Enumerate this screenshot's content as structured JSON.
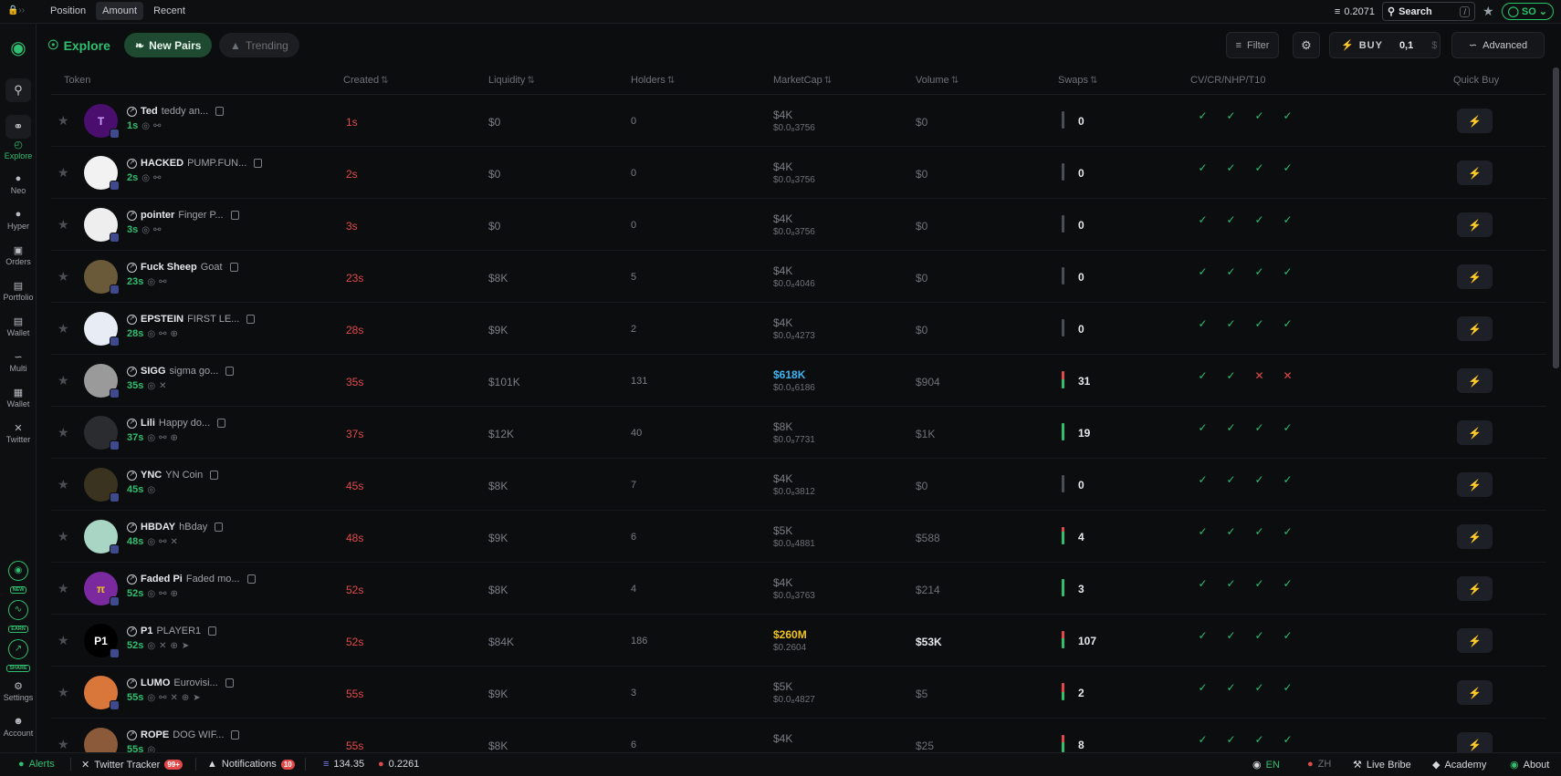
{
  "topbar": {
    "tabs": [
      {
        "label": "Position",
        "active": false
      },
      {
        "label": "Amount",
        "active": true
      },
      {
        "label": "Recent",
        "active": false
      }
    ],
    "balance": "0.2071",
    "search_label": "Search",
    "search_shortcut": "/",
    "user_initials": "SO"
  },
  "sidebar": {
    "items": [
      {
        "label": "Explore",
        "icon": "explore-icon",
        "active": true
      },
      {
        "label": "Neo",
        "icon": "neo-icon",
        "active": false
      },
      {
        "label": "Hyper",
        "icon": "hyper-icon",
        "active": false
      },
      {
        "label": "Orders",
        "icon": "orders-icon",
        "active": false
      },
      {
        "label": "Portfolio",
        "icon": "portfolio-icon",
        "active": false
      },
      {
        "label": "Wallet",
        "icon": "wallet-icon",
        "active": false
      },
      {
        "label": "Multi",
        "icon": "multi-chart-icon",
        "active": false
      },
      {
        "label": "Wallet",
        "icon": "wallet-doc-icon",
        "active": false
      },
      {
        "label": "Twitter",
        "icon": "x-icon",
        "active": false
      }
    ],
    "promos": [
      "NEW",
      "EARN",
      "SHARE"
    ],
    "bottom": [
      {
        "label": "Settings",
        "icon": "gear-icon"
      },
      {
        "label": "Account",
        "icon": "account-icon"
      }
    ]
  },
  "header": {
    "title": "Explore",
    "new_pairs": "New Pairs",
    "trending": "Trending",
    "filter": "Filter",
    "buy_label": "BUY",
    "buy_amount": "0,1",
    "buy_currency": "$",
    "advanced": "Advanced"
  },
  "table": {
    "columns": [
      "Token",
      "Created",
      "Liquidity",
      "Holders",
      "MarketCap",
      "Volume",
      "Swaps",
      "CV/CR/NHP/T10",
      "Quick Buy"
    ],
    "rows": [
      {
        "symbol": "Ted",
        "name": "teddy an...",
        "age": "1s",
        "created": "1s",
        "liquidity": "$0",
        "holders": "0",
        "mcap": "$4K",
        "price": "$0.0₈3756",
        "mcap_style": "normal",
        "volume": "$0",
        "volume_strong": false,
        "swaps": "0",
        "buy_frac": 0,
        "sell_frac": 0,
        "checks": [
          "ok",
          "ok",
          "ok",
          "ok"
        ],
        "avatar_text": "T",
        "avatar_bg": "#4a0f6e",
        "avatar_fg": "#c8a0ff",
        "socials": [
          "stat",
          "link"
        ]
      },
      {
        "symbol": "HACKED",
        "name": "PUMP.FUN...",
        "age": "2s",
        "created": "2s",
        "liquidity": "$0",
        "holders": "0",
        "mcap": "$4K",
        "price": "$0.0₈3756",
        "mcap_style": "normal",
        "volume": "$0",
        "volume_strong": false,
        "swaps": "0",
        "buy_frac": 0,
        "sell_frac": 0,
        "checks": [
          "ok",
          "ok",
          "ok",
          "ok"
        ],
        "avatar_text": "",
        "avatar_bg": "#f2f2f2",
        "avatar_fg": "#222",
        "socials": [
          "stat",
          "link"
        ]
      },
      {
        "symbol": "pointer",
        "name": "Finger P...",
        "age": "3s",
        "created": "3s",
        "liquidity": "$0",
        "holders": "0",
        "mcap": "$4K",
        "price": "$0.0₈3756",
        "mcap_style": "normal",
        "volume": "$0",
        "volume_strong": false,
        "swaps": "0",
        "buy_frac": 0,
        "sell_frac": 0,
        "checks": [
          "ok",
          "ok",
          "ok",
          "ok"
        ],
        "avatar_text": "",
        "avatar_bg": "#eeeeee",
        "avatar_fg": "#222",
        "socials": [
          "stat",
          "link"
        ]
      },
      {
        "symbol": "Fuck Sheep",
        "name": "Goat",
        "age": "23s",
        "created": "23s",
        "liquidity": "$8K",
        "holders": "5",
        "mcap": "$4K",
        "price": "$0.0₈4046",
        "mcap_style": "normal",
        "volume": "$0",
        "volume_strong": false,
        "swaps": "0",
        "buy_frac": 0,
        "sell_frac": 0,
        "checks": [
          "ok",
          "ok",
          "ok",
          "ok"
        ],
        "avatar_text": "",
        "avatar_bg": "#6b5a3a",
        "avatar_fg": "#fff",
        "socials": [
          "stat",
          "link"
        ]
      },
      {
        "symbol": "EPSTEIN",
        "name": "FIRST LE...",
        "age": "28s",
        "created": "28s",
        "liquidity": "$9K",
        "holders": "2",
        "mcap": "$4K",
        "price": "$0.0₈4273",
        "mcap_style": "normal",
        "volume": "$0",
        "volume_strong": false,
        "swaps": "0",
        "buy_frac": 0,
        "sell_frac": 0,
        "checks": [
          "ok",
          "ok",
          "ok",
          "ok"
        ],
        "avatar_text": "",
        "avatar_bg": "#e8ecf4",
        "avatar_fg": "#333",
        "socials": [
          "stat",
          "link",
          "web"
        ]
      },
      {
        "symbol": "SIGG",
        "name": "sigma go...",
        "age": "35s",
        "created": "35s",
        "liquidity": "$101K",
        "holders": "131",
        "mcap": "$618K",
        "price": "$0.0₈6186",
        "mcap_style": "hi",
        "volume": "$904",
        "volume_strong": false,
        "swaps": "31",
        "buy_frac": 0.55,
        "sell_frac": 0.45,
        "checks": [
          "ok",
          "ok",
          "bad",
          "bad"
        ],
        "avatar_text": "",
        "avatar_bg": "#9a9a9a",
        "avatar_fg": "#fff",
        "socials": [
          "stat",
          "x"
        ]
      },
      {
        "symbol": "Lili",
        "name": "Happy do...",
        "age": "37s",
        "created": "37s",
        "liquidity": "$12K",
        "holders": "40",
        "mcap": "$8K",
        "price": "$0.0₈7731",
        "mcap_style": "normal",
        "volume": "$1K",
        "volume_strong": false,
        "swaps": "19",
        "buy_frac": 1,
        "sell_frac": 0,
        "checks": [
          "ok",
          "ok",
          "ok",
          "ok"
        ],
        "avatar_text": "",
        "avatar_bg": "#2a2c30",
        "avatar_fg": "#fff",
        "socials": [
          "stat",
          "link",
          "web"
        ]
      },
      {
        "symbol": "YNC",
        "name": "YN Coin",
        "age": "45s",
        "created": "45s",
        "liquidity": "$8K",
        "holders": "7",
        "mcap": "$4K",
        "price": "$0.0₈3812",
        "mcap_style": "normal",
        "volume": "$0",
        "volume_strong": false,
        "swaps": "0",
        "buy_frac": 0,
        "sell_frac": 0,
        "checks": [
          "ok",
          "ok",
          "ok",
          "ok"
        ],
        "avatar_text": "",
        "avatar_bg": "#3a3320",
        "avatar_fg": "#e6c04a",
        "socials": [
          "stat"
        ]
      },
      {
        "symbol": "HBDAY",
        "name": "hBday",
        "age": "48s",
        "created": "48s",
        "liquidity": "$9K",
        "holders": "6",
        "mcap": "$5K",
        "price": "$0.0₈4881",
        "mcap_style": "normal",
        "volume": "$588",
        "volume_strong": false,
        "swaps": "4",
        "buy_frac": 0.75,
        "sell_frac": 0.25,
        "checks": [
          "ok",
          "ok",
          "ok",
          "ok"
        ],
        "avatar_text": "",
        "avatar_bg": "#a9d6c4",
        "avatar_fg": "#222",
        "socials": [
          "stat",
          "link",
          "x"
        ]
      },
      {
        "symbol": "Faded Pi",
        "name": "Faded mo...",
        "age": "52s",
        "created": "52s",
        "liquidity": "$8K",
        "holders": "4",
        "mcap": "$4K",
        "price": "$0.0₈3763",
        "mcap_style": "normal",
        "volume": "$214",
        "volume_strong": false,
        "swaps": "3",
        "buy_frac": 1,
        "sell_frac": 0,
        "checks": [
          "ok",
          "ok",
          "ok",
          "ok"
        ],
        "avatar_text": "π",
        "avatar_bg": "#7a2a9e",
        "avatar_fg": "#f0c41e",
        "socials": [
          "stat",
          "link",
          "web"
        ]
      },
      {
        "symbol": "P1",
        "name": "PLAYER1",
        "age": "52s",
        "created": "52s",
        "liquidity": "$84K",
        "holders": "186",
        "mcap": "$260M",
        "price": "$0.2604",
        "mcap_style": "gold",
        "volume": "$53K",
        "volume_strong": true,
        "swaps": "107",
        "buy_frac": 0.6,
        "sell_frac": 0.4,
        "checks": [
          "ok",
          "ok",
          "ok",
          "ok"
        ],
        "avatar_text": "P1",
        "avatar_bg": "#000000",
        "avatar_fg": "#ffffff",
        "socials": [
          "stat",
          "x",
          "web",
          "telegram"
        ]
      },
      {
        "symbol": "LUMO",
        "name": "Eurovisi...",
        "age": "55s",
        "created": "55s",
        "liquidity": "$9K",
        "holders": "3",
        "mcap": "$5K",
        "price": "$0.0₈4827",
        "mcap_style": "normal",
        "volume": "$5",
        "volume_strong": false,
        "swaps": "2",
        "buy_frac": 0.5,
        "sell_frac": 0.5,
        "checks": [
          "ok",
          "ok",
          "ok",
          "ok"
        ],
        "avatar_text": "",
        "avatar_bg": "#d9763a",
        "avatar_fg": "#fff",
        "socials": [
          "stat",
          "link",
          "x",
          "web",
          "telegram"
        ]
      },
      {
        "symbol": "ROPE",
        "name": "DOG WIF...",
        "age": "55s",
        "created": "55s",
        "liquidity": "$8K",
        "holders": "6",
        "mcap": "$4K",
        "price": "",
        "mcap_style": "normal",
        "volume": "$25",
        "volume_strong": false,
        "swaps": "8",
        "buy_frac": 0.6,
        "sell_frac": 0.4,
        "checks": [
          "ok",
          "ok",
          "ok",
          "ok"
        ],
        "avatar_text": "",
        "avatar_bg": "#8a5a3a",
        "avatar_fg": "#fff",
        "socials": [
          "stat"
        ]
      }
    ]
  },
  "footer": {
    "alerts": "Alerts",
    "twitter_tracker": "Twitter Tracker",
    "twitter_badge": "99+",
    "notifications": "Notifications",
    "notifications_badge": "10",
    "stat1": "134.35",
    "stat2": "0.2261",
    "lang_en": "EN",
    "lang_zh": "ZH",
    "live_bribe": "Live Bribe",
    "academy": "Academy",
    "about": "About"
  },
  "colors": {
    "accent": "#2fbf71",
    "danger": "#e24a4a",
    "info": "#3db5f0",
    "gold": "#f0c41e"
  }
}
